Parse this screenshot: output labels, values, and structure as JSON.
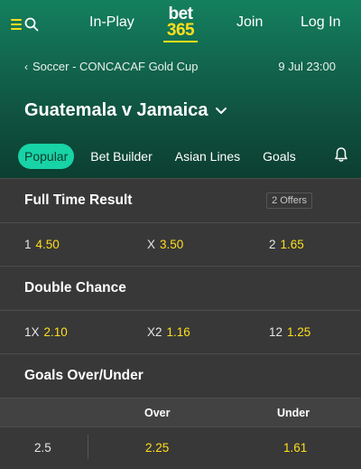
{
  "nav": {
    "in_play": "In-Play",
    "logo_top": "bet",
    "logo_bottom": "365",
    "join": "Join",
    "login": "Log In"
  },
  "event": {
    "breadcrumb": "Soccer - CONCACAF Gold Cup",
    "datetime": "9 Jul 23:00",
    "title": "Guatemala v Jamaica"
  },
  "tabs": [
    {
      "label": "Popular",
      "active": true
    },
    {
      "label": "Bet Builder"
    },
    {
      "label": "Asian Lines"
    },
    {
      "label": "Goals"
    }
  ],
  "markets": {
    "full_time": {
      "title": "Full Time Result",
      "offers": "2 Offers",
      "odds": [
        {
          "label": "1",
          "value": "4.50"
        },
        {
          "label": "X",
          "value": "3.50"
        },
        {
          "label": "2",
          "value": "1.65"
        }
      ]
    },
    "double_chance": {
      "title": "Double Chance",
      "odds": [
        {
          "label": "1X",
          "value": "2.10"
        },
        {
          "label": "X2",
          "value": "1.16"
        },
        {
          "label": "12",
          "value": "1.25"
        }
      ]
    },
    "goals_ou": {
      "title": "Goals Over/Under",
      "col_over": "Over",
      "col_under": "Under",
      "rows": [
        {
          "line": "2.5",
          "over": "2.25",
          "under": "1.61"
        }
      ]
    }
  },
  "colors": {
    "brand_green": "#126a50",
    "accent_yellow": "#ffdf1b",
    "active_tab": "#17d3a6",
    "panel_bg": "#383838"
  }
}
